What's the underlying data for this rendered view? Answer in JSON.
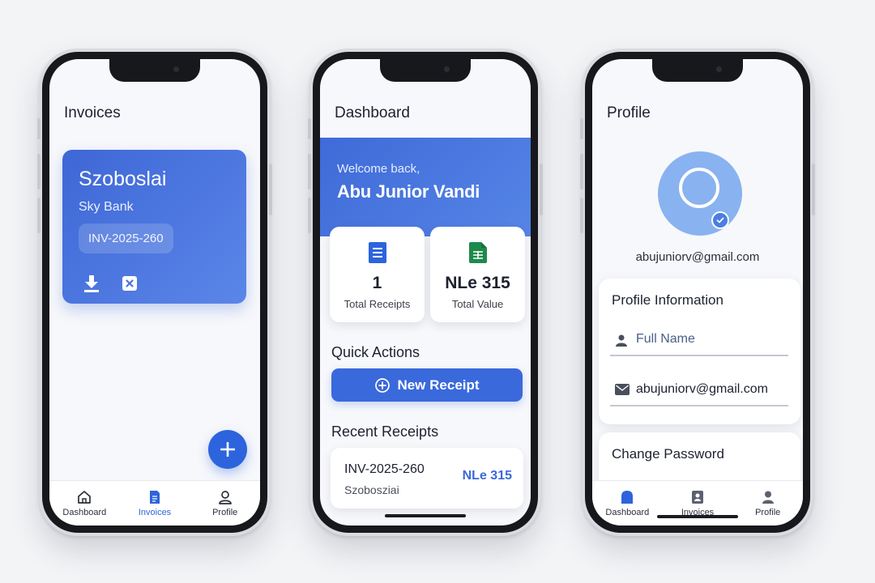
{
  "colors": {
    "accent": "#2d63dd",
    "banner": "#3f6ad8",
    "text": "#1d2230",
    "avatar": "#89b2f0",
    "receipt_icon": "#2d63dd",
    "value_icon": "#1e8a4a"
  },
  "invoices_screen": {
    "title": "Invoices",
    "invoice_card": {
      "client": "Szoboslai",
      "bank": "Sky Bank",
      "invoice_id": "INV-2025-260",
      "icons": [
        "download-icon",
        "delete-icon"
      ]
    },
    "fab_icon": "plus-icon",
    "tabs": [
      {
        "label": "Dashboard",
        "icon": "home-icon",
        "active": false
      },
      {
        "label": "Invoices",
        "icon": "document-icon",
        "active": true
      },
      {
        "label": "Profile",
        "icon": "user-icon",
        "active": false
      }
    ]
  },
  "dashboard_screen": {
    "title": "Dashboard",
    "welcome": "Welcome back,",
    "user_name": "Abu Junior Vandi",
    "stats": [
      {
        "value": "1",
        "label": "Total Receipts",
        "icon": "receipt-icon"
      },
      {
        "value": "NLe 315",
        "label": "Total Value",
        "icon": "spreadsheet-icon"
      }
    ],
    "quick_actions_heading": "Quick Actions",
    "new_receipt_label": "New Receipt",
    "recent_heading": "Recent Receipts",
    "recent": [
      {
        "id": "INV-2025-260",
        "client": "Szobosziai",
        "amount": "NLe 315"
      }
    ]
  },
  "profile_screen": {
    "title": "Profile",
    "email": "abujuniorv@gmail.com",
    "info_heading": "Profile Information",
    "full_name_placeholder": "Full Name",
    "email_field_value": "abujuniorv@gmail.com",
    "password_heading": "Change Password",
    "tabs": [
      {
        "label": "Dashboard",
        "icon": "home-icon",
        "active": true
      },
      {
        "label": "Invoices",
        "icon": "invoice-icon",
        "active": false
      },
      {
        "label": "Profile",
        "icon": "user-icon",
        "active": false
      }
    ]
  }
}
